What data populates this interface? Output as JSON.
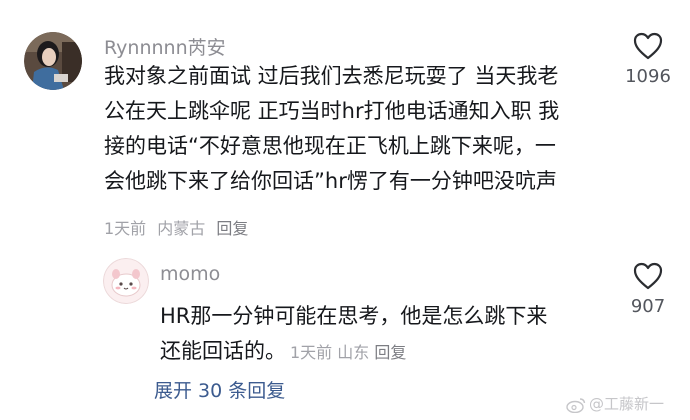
{
  "comment": {
    "username": "Rynnnnn芮安",
    "body_lines": [
      "我对象之前面试 过后我们去悉尼玩耍了 当天我老",
      "公在天上跳伞呢 正巧当时hr打他电话通知入职 我",
      "接的电话“不好意思他现在正飞机上跳下来呢，一",
      "会他跳下来了给你回话”hr愣了有一分钟吧没吭声"
    ],
    "time": "1天前",
    "location": "内蒙古",
    "reply_label": "回复",
    "likes": "1096",
    "icon": "heart-outline-icon"
  },
  "reply": {
    "username": "momo",
    "body_lines": [
      "HR那一分钟可能在思考，他是怎么跳下来",
      "还能回话的。"
    ],
    "time": "1天前",
    "location": "山东",
    "reply_label": "回复",
    "likes": "907",
    "icon": "heart-outline-icon"
  },
  "expand_replies": "展开 30 条回复",
  "watermark": "@工藤新一",
  "colors": {
    "username": "#8d8d93",
    "body": "#16181c",
    "meta": "#a1a2a8",
    "link": "#3c5b8f"
  }
}
